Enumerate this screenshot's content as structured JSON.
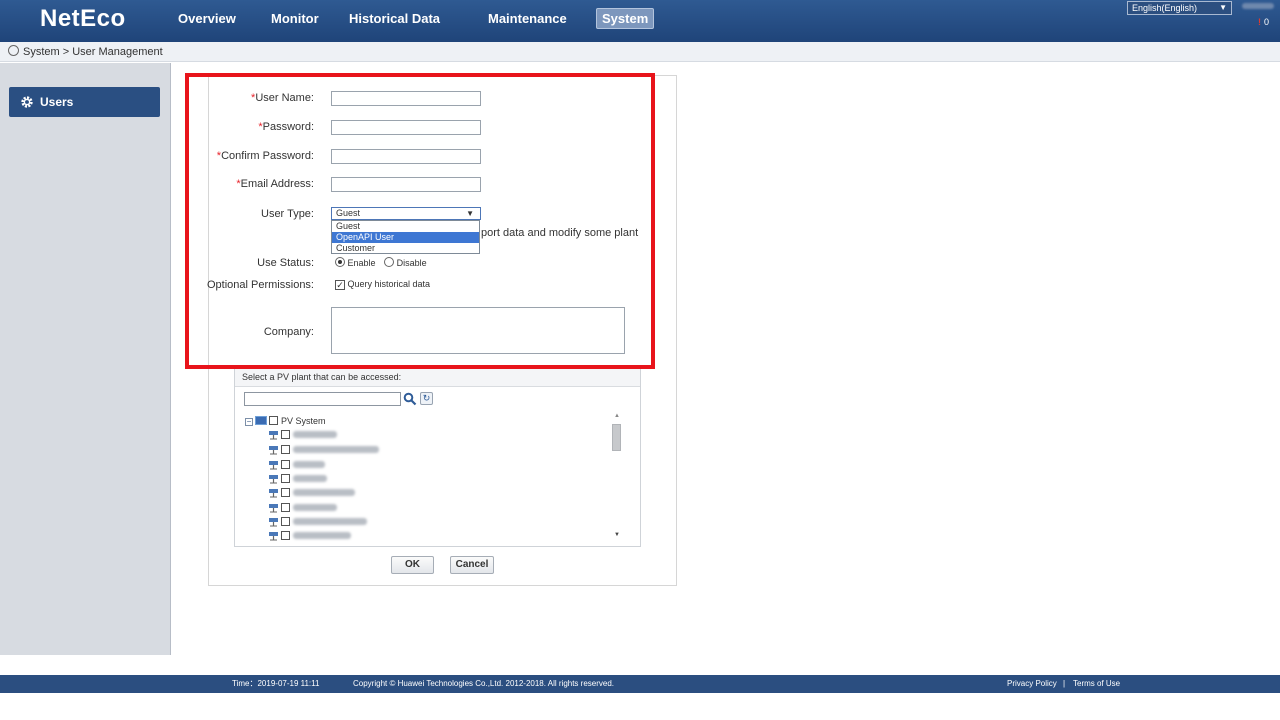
{
  "header": {
    "logo": "NetEco",
    "nav": [
      {
        "label": "Overview"
      },
      {
        "label": "Monitor"
      },
      {
        "label": "Historical Data"
      },
      {
        "label": "Maintenance"
      },
      {
        "label": "System"
      }
    ],
    "language": "English(English)",
    "alarm_count": "0"
  },
  "breadcrumb": "System > User Management",
  "sidebar": {
    "items": [
      {
        "label": "Users"
      }
    ]
  },
  "form": {
    "user_name_label": "User Name:",
    "password_label": "Password:",
    "confirm_password_label": "Confirm Password:",
    "email_label": "Email Address:",
    "user_type_label": "User Type:",
    "user_type_value": "Guest",
    "user_type_options": [
      "Guest",
      "OpenAPI User",
      "Customer"
    ],
    "user_type_selected_index": 1,
    "description_fragment": "port data and modify some plant",
    "use_status_label": "Use Status:",
    "enable_label": "Enable",
    "disable_label": "Disable",
    "optional_permissions_label": "Optional Permissions:",
    "query_historical_label": "Query historical data",
    "company_label": "Company:",
    "required_mark": "*"
  },
  "plant_selector": {
    "header": "Select a PV plant that can be accessed:",
    "root_label": "PV System"
  },
  "buttons": {
    "ok": "OK",
    "cancel": "Cancel"
  },
  "footer": {
    "time": "Time：2019-07-19 11:11",
    "copyright": "Copyright © Huawei Technologies Co.,Ltd. 2012-2018. All rights reserved.",
    "privacy": "Privacy Policy",
    "separator": "|",
    "terms": "Terms of Use"
  },
  "colors": {
    "header_bg": "#1f4479",
    "highlight": "#e8141b",
    "selection": "#3e77d3",
    "required": "#e8232b"
  }
}
